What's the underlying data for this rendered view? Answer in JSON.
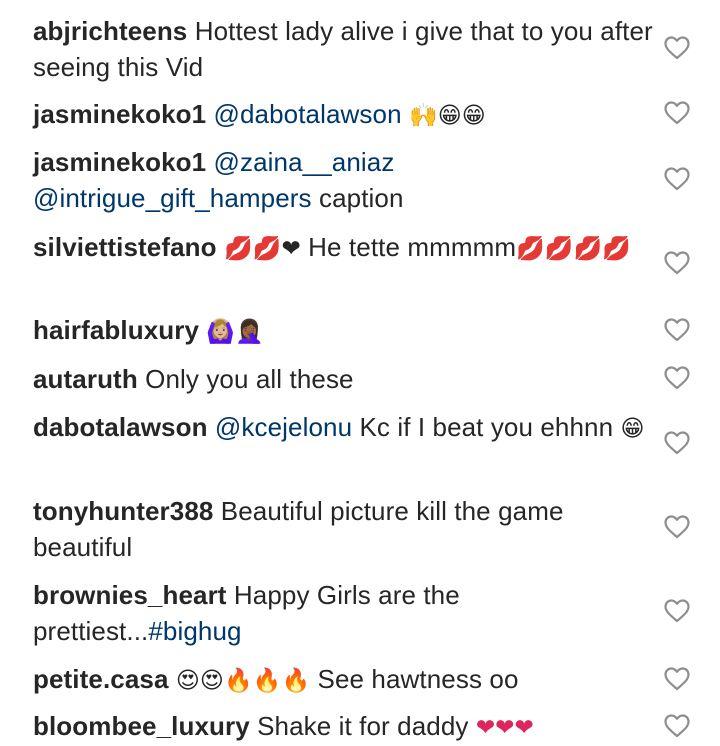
{
  "comments": [
    {
      "user": "abjrichteens",
      "text": "Hottest lady alive i give that to you after seeing this Vid"
    },
    {
      "user": "jasminekoko1",
      "mention": "@dabotalawson",
      "emoji": "🙌😁😁"
    },
    {
      "user": "jasminekoko1",
      "mention": "@zaina__aniaz",
      "mention2": "@intrigue_gift_hampers",
      "text": "caption"
    },
    {
      "user": "silviettistefano",
      "emoji": "💋💋❤",
      "text": "He tette mmmmm",
      "emoji2": "💋💋💋💋"
    },
    {
      "user": "hairfabluxury",
      "emoji": "🙆🏼‍♀️🤦🏾‍♀️"
    },
    {
      "user": "autaruth",
      "text": "Only you all these"
    },
    {
      "user": "dabotalawson",
      "mention": "@kcejelonu",
      "text": "Kc if I beat you ehhnn",
      "emoji": "😁"
    },
    {
      "user": "tonyhunter388",
      "text": "Beautiful picture kill the game beautiful"
    },
    {
      "user": "brownies_heart",
      "text": "Happy Girls are the prettiest...",
      "tag": "#bighug"
    },
    {
      "user": "petite.casa",
      "emoji": "😍😍🔥🔥🔥",
      "text": "See hawtness oo"
    },
    {
      "user": "bloombee_luxury",
      "text": "Shake it for daddy",
      "emoji": "❤❤❤"
    }
  ],
  "icons": {
    "like": "heart-outline-icon"
  },
  "colors": {
    "text": "#262626",
    "mention": "#00376b",
    "icon": "#8e8e8e"
  }
}
